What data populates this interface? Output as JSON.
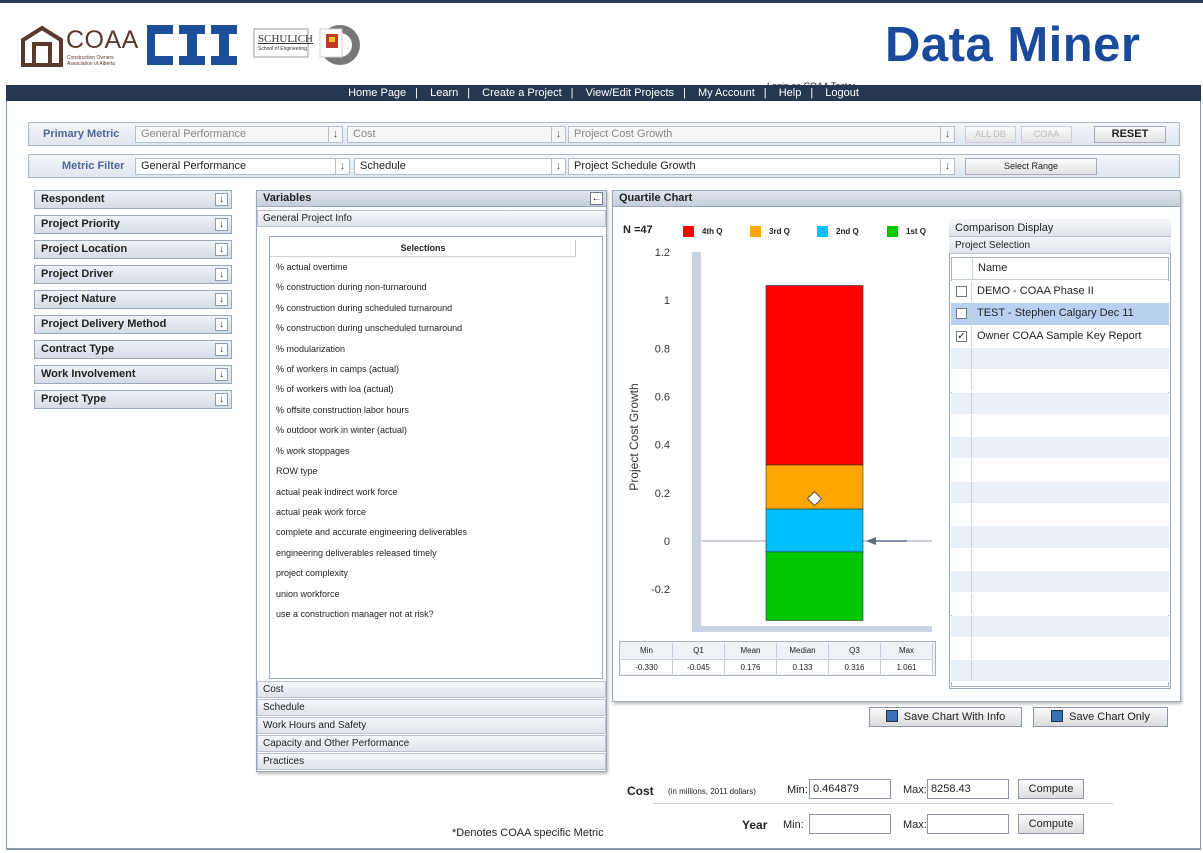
{
  "header": {
    "coaa_logo_text": "COAA",
    "coaa_logo_sub1": "Construction Owners",
    "coaa_logo_sub2": "Association of Alberta",
    "cii_logo_text": "CII",
    "schulich_text": "SCHULICH",
    "schulich_sub": "School of Engineering",
    "login_text": "Login as COAA Tester",
    "app_title": "Data Miner"
  },
  "nav": {
    "items": [
      "Home Page",
      "Learn",
      "Create a Project",
      "View/Edit Projects",
      "My Account",
      "Help",
      "Logout"
    ]
  },
  "primary_metric": {
    "label": "Primary Metric",
    "field1": "General Performance",
    "field2": "Cost",
    "field3": "Project Cost Growth",
    "btn_alldb": "ALL DB",
    "btn_coaa": "COAA",
    "btn_reset": "RESET"
  },
  "metric_filter": {
    "label": "Metric Filter",
    "field1": "General Performance",
    "field2": "Schedule",
    "field3": "Project Schedule Growth",
    "btn_range": "Select Range"
  },
  "sidebar": {
    "items": [
      "Respondent",
      "Project Priority",
      "Project Location",
      "Project Driver",
      "Project Nature",
      "Project Delivery Method",
      "Contract Type",
      "Work Involvement",
      "Project Type"
    ]
  },
  "variables": {
    "title": "Variables",
    "open_section": "General Project Info",
    "selections_header": "Selections",
    "selections": [
      "% actual overtime",
      "% construction during non-turnaround",
      "% construction during scheduled turnaround",
      "% construction during unscheduled turnaround",
      "% modularization",
      "% of workers in camps (actual)",
      "% of workers with loa (actual)",
      "% offsite construction labor hours",
      "% outdoor work in winter (actual)",
      "% work stoppages",
      "ROW type",
      "actual peak indirect work force",
      "actual peak work force",
      "complete and accurate engineering deliverables",
      "engineering deliverables released timely",
      "project complexity",
      "union workforce",
      "use a construction manager not at risk?"
    ],
    "sections": [
      "Cost",
      "Schedule",
      "Work Hours and Safety",
      "Capacity and Other Performance",
      "Practices"
    ]
  },
  "quartile": {
    "title": "Quartile Chart",
    "n_label": "N =47",
    "legend": [
      {
        "label": "4th Q",
        "color": "#ff0000"
      },
      {
        "label": "3rd Q",
        "color": "#ffa500"
      },
      {
        "label": "2nd Q",
        "color": "#00bfff"
      },
      {
        "label": "1st Q",
        "color": "#00c800"
      }
    ],
    "ylabel": "Project Cost Growth",
    "stats_headers": [
      "Min",
      "Q1",
      "Mean",
      "Median",
      "Q3",
      "Max"
    ],
    "stats_values": [
      "-0.330",
      "-0.045",
      "0.176",
      "0.133",
      "0.316",
      "1.061"
    ],
    "arrow_value": 0.0
  },
  "chart_data": {
    "type": "bar",
    "title": "",
    "ylabel": "Project Cost Growth",
    "ylim": [
      -0.3,
      1.2
    ],
    "yticks": [
      1.2,
      1,
      0.8,
      0.6,
      0.4,
      0.2,
      0,
      -0.2
    ],
    "quartiles": {
      "min": -0.33,
      "q1": -0.045,
      "mean": 0.176,
      "median": 0.133,
      "q3": 0.316,
      "max": 1.061
    },
    "series": [
      {
        "name": "1st Q",
        "from": -0.33,
        "to": -0.045,
        "color": "#00c800"
      },
      {
        "name": "2nd Q",
        "from": -0.045,
        "to": 0.133,
        "color": "#00bfff"
      },
      {
        "name": "3rd Q",
        "from": 0.133,
        "to": 0.316,
        "color": "#ffa500"
      },
      {
        "name": "4th Q",
        "from": 0.316,
        "to": 1.061,
        "color": "#ff0000"
      }
    ]
  },
  "comparison": {
    "title": "Comparison Display",
    "subtitle": "Project Selection",
    "name_header": "Name",
    "projects": [
      {
        "name": "DEMO - COAA Phase II",
        "checked": false
      },
      {
        "name": "TEST - Stephen Calgary Dec 11",
        "checked": false
      },
      {
        "name": "Owner COAA Sample Key Report",
        "checked": true
      }
    ]
  },
  "actions": {
    "save_with_info": "Save Chart With Info",
    "save_only": "Save Chart Only"
  },
  "cost_filter": {
    "label": "Cost",
    "units": "(in millions, 2011 dollars)",
    "min_label": "Min:",
    "min_value": "0.464879",
    "max_label": "Max:",
    "max_value": "8258.43",
    "compute": "Compute"
  },
  "year_filter": {
    "label": "Year",
    "min_label": "Min:",
    "min_value": "",
    "max_label": "Max:",
    "max_value": "",
    "compute": "Compute"
  },
  "footnote": "*Denotes COAA specific Metric"
}
